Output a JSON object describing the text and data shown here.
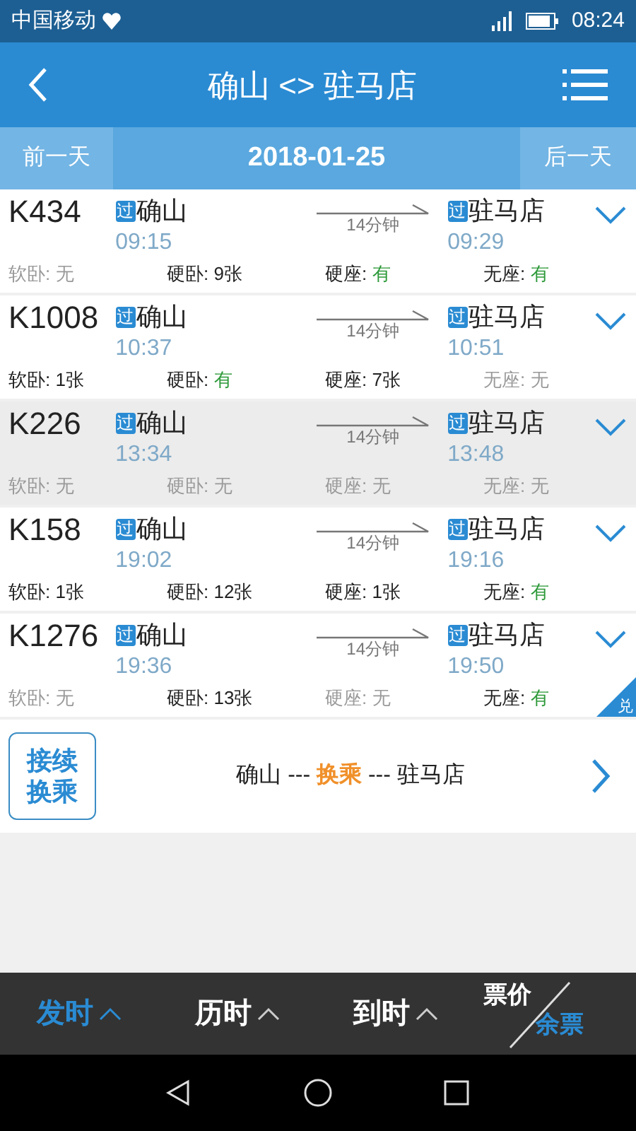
{
  "status_bar": {
    "carrier": "中国移动",
    "time": "08:24"
  },
  "header": {
    "title": "确山 <> 驻马店"
  },
  "date_bar": {
    "prev": "前一天",
    "date": "2018-01-25",
    "next": "后一天"
  },
  "trains": [
    {
      "number": "K434",
      "from_tag": "过",
      "from": "确山",
      "depart": "09:15",
      "duration": "14分钟",
      "to_tag": "过",
      "to": "驻马店",
      "arrive": "09:29",
      "selected": false,
      "seats": [
        {
          "label": "软卧:",
          "value": "无",
          "kind": "none"
        },
        {
          "label": "硬卧:",
          "value": "9张",
          "kind": "count"
        },
        {
          "label": "硬座:",
          "value": "有",
          "kind": "plenty"
        },
        {
          "label": "无座:",
          "value": "有",
          "kind": "plenty"
        }
      ]
    },
    {
      "number": "K1008",
      "from_tag": "过",
      "from": "确山",
      "depart": "10:37",
      "duration": "14分钟",
      "to_tag": "过",
      "to": "驻马店",
      "arrive": "10:51",
      "selected": false,
      "seats": [
        {
          "label": "软卧:",
          "value": "1张",
          "kind": "count"
        },
        {
          "label": "硬卧:",
          "value": "有",
          "kind": "plenty"
        },
        {
          "label": "硬座:",
          "value": "7张",
          "kind": "count"
        },
        {
          "label": "无座:",
          "value": "无",
          "kind": "none"
        }
      ]
    },
    {
      "number": "K226",
      "from_tag": "过",
      "from": "确山",
      "depart": "13:34",
      "duration": "14分钟",
      "to_tag": "过",
      "to": "驻马店",
      "arrive": "13:48",
      "selected": true,
      "seats": [
        {
          "label": "软卧:",
          "value": "无",
          "kind": "none"
        },
        {
          "label": "硬卧:",
          "value": "无",
          "kind": "none"
        },
        {
          "label": "硬座:",
          "value": "无",
          "kind": "none"
        },
        {
          "label": "无座:",
          "value": "无",
          "kind": "none"
        }
      ]
    },
    {
      "number": "K158",
      "from_tag": "过",
      "from": "确山",
      "depart": "19:02",
      "duration": "14分钟",
      "to_tag": "过",
      "to": "驻马店",
      "arrive": "19:16",
      "selected": false,
      "seats": [
        {
          "label": "软卧:",
          "value": "1张",
          "kind": "count"
        },
        {
          "label": "硬卧:",
          "value": "12张",
          "kind": "count"
        },
        {
          "label": "硬座:",
          "value": "1张",
          "kind": "count"
        },
        {
          "label": "无座:",
          "value": "有",
          "kind": "plenty"
        }
      ]
    },
    {
      "number": "K1276",
      "from_tag": "过",
      "from": "确山",
      "depart": "19:36",
      "duration": "14分钟",
      "to_tag": "过",
      "to": "驻马店",
      "arrive": "19:50",
      "selected": false,
      "badge": "兑",
      "seats": [
        {
          "label": "软卧:",
          "value": "无",
          "kind": "none"
        },
        {
          "label": "硬卧:",
          "value": "13张",
          "kind": "count"
        },
        {
          "label": "硬座:",
          "value": "无",
          "kind": "none"
        },
        {
          "label": "无座:",
          "value": "有",
          "kind": "plenty"
        }
      ]
    }
  ],
  "transfer": {
    "badge_line1": "接续",
    "badge_line2": "换乘",
    "from": "确山 ---",
    "middle": "换乘",
    "to": "--- 驻马店"
  },
  "sort_bar": [
    {
      "label": "发时",
      "selected": true
    },
    {
      "label": "历时",
      "selected": false
    },
    {
      "label": "到时",
      "selected": false
    }
  ],
  "price_toggle": [
    {
      "label": "票价",
      "selected": false
    },
    {
      "label": "余票",
      "selected": true
    }
  ]
}
